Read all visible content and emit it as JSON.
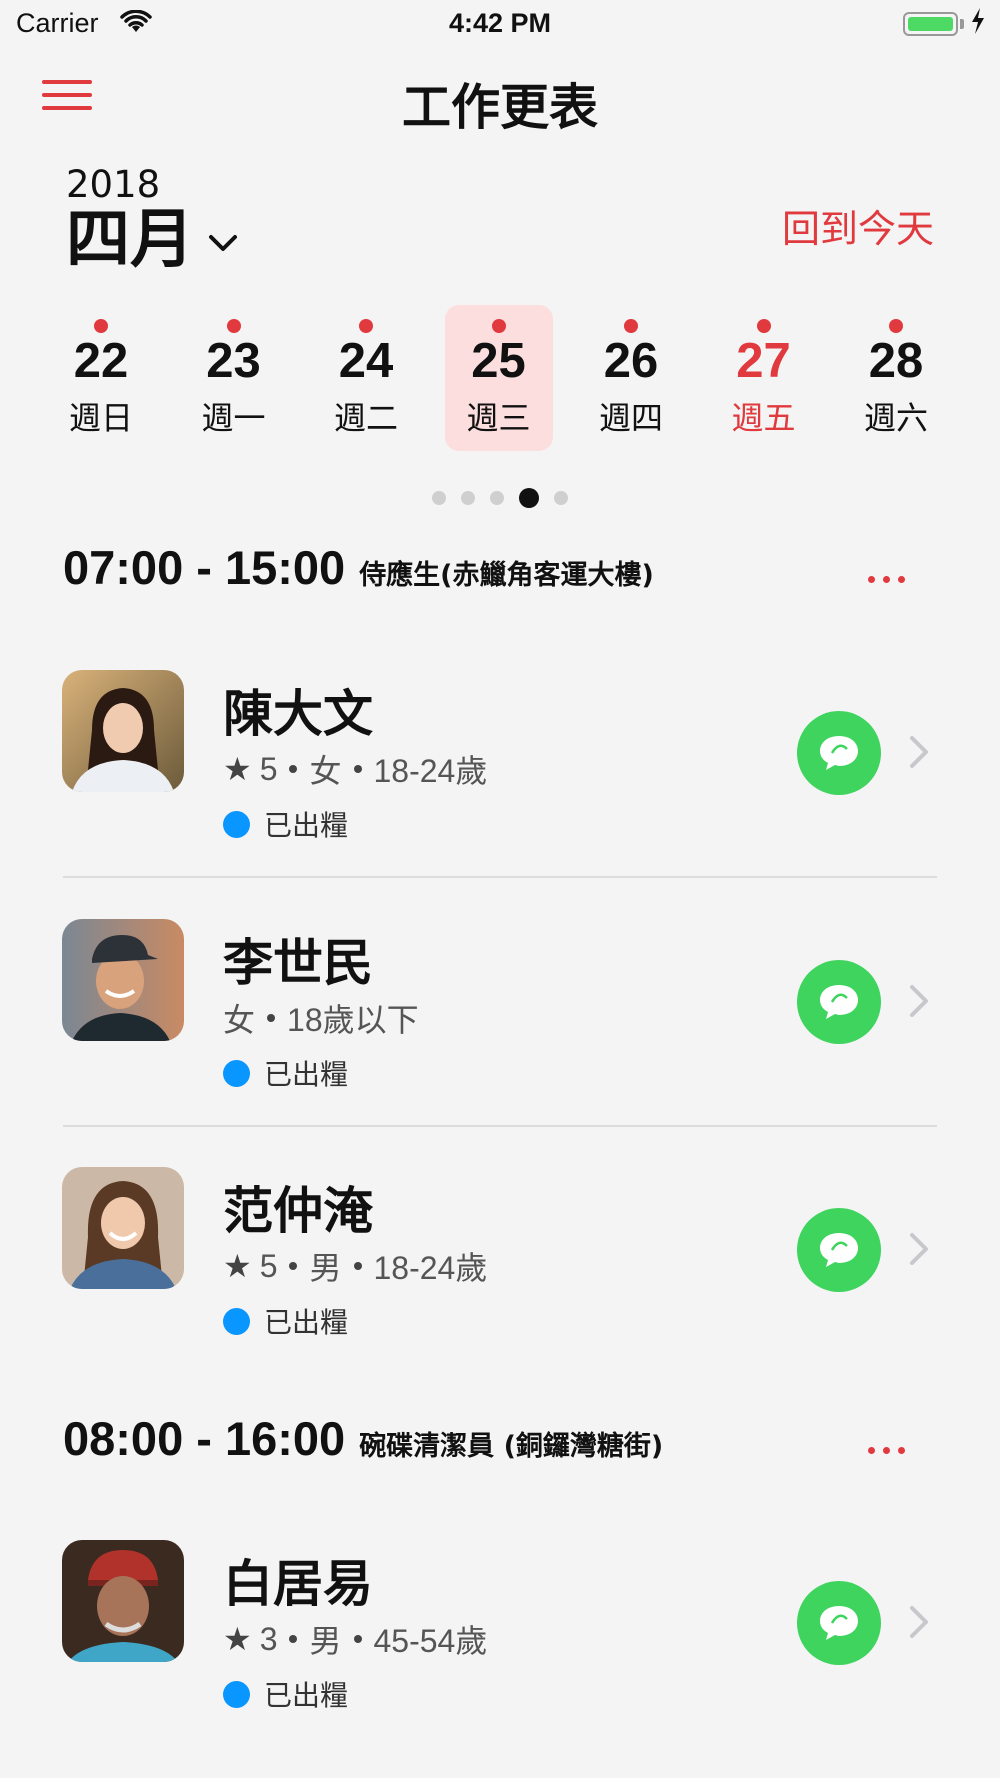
{
  "status_bar": {
    "carrier": "Carrier",
    "time": "4:42 PM",
    "battery_level": 1.0,
    "battery_color": "#4cd964"
  },
  "nav": {
    "title": "工作更表",
    "menu_icon": "hamburger-icon"
  },
  "calendar": {
    "year": "2018",
    "month": "四月",
    "today_label": "回到今天",
    "days": [
      {
        "num": "22",
        "weekday": "週日",
        "has_event": true,
        "selected": false,
        "highlight": false
      },
      {
        "num": "23",
        "weekday": "週一",
        "has_event": true,
        "selected": false,
        "highlight": false
      },
      {
        "num": "24",
        "weekday": "週二",
        "has_event": true,
        "selected": false,
        "highlight": false
      },
      {
        "num": "25",
        "weekday": "週三",
        "has_event": true,
        "selected": true,
        "highlight": false
      },
      {
        "num": "26",
        "weekday": "週四",
        "has_event": true,
        "selected": false,
        "highlight": false
      },
      {
        "num": "27",
        "weekday": "週五",
        "has_event": true,
        "selected": false,
        "highlight": true
      },
      {
        "num": "28",
        "weekday": "週六",
        "has_event": true,
        "selected": false,
        "highlight": false
      }
    ],
    "pager": {
      "count": 5,
      "active": 3
    }
  },
  "shifts": [
    {
      "time": "07:00 - 15:00",
      "role": "侍應生(赤鱲角客運大樓)",
      "workers": [
        {
          "name": "陳大文",
          "rating": "5",
          "meta": [
            "女",
            "18-24歲"
          ],
          "status": "已出糧",
          "avatar": "avatar-young-woman"
        },
        {
          "name": "李世民",
          "rating": null,
          "meta": [
            "女",
            "18歲以下"
          ],
          "status": "已出糧",
          "avatar": "avatar-man-cap"
        },
        {
          "name": "范仲淹",
          "rating": "5",
          "meta": [
            "男",
            "18-24歲"
          ],
          "status": "已出糧",
          "avatar": "avatar-woman-smiling"
        }
      ]
    },
    {
      "time": "08:00 - 16:00",
      "role": "碗碟清潔員 (銅鑼灣糖街)",
      "workers": [
        {
          "name": "白居易",
          "rating": "3",
          "meta": [
            "男",
            "45-54歲"
          ],
          "status": "已出糧",
          "avatar": "avatar-old-man"
        }
      ]
    }
  ],
  "colors": {
    "accent": "#e0393e",
    "chat": "#3ed45e",
    "status_dot": "#0a96ff",
    "selected_day_bg": "#fcdede"
  }
}
